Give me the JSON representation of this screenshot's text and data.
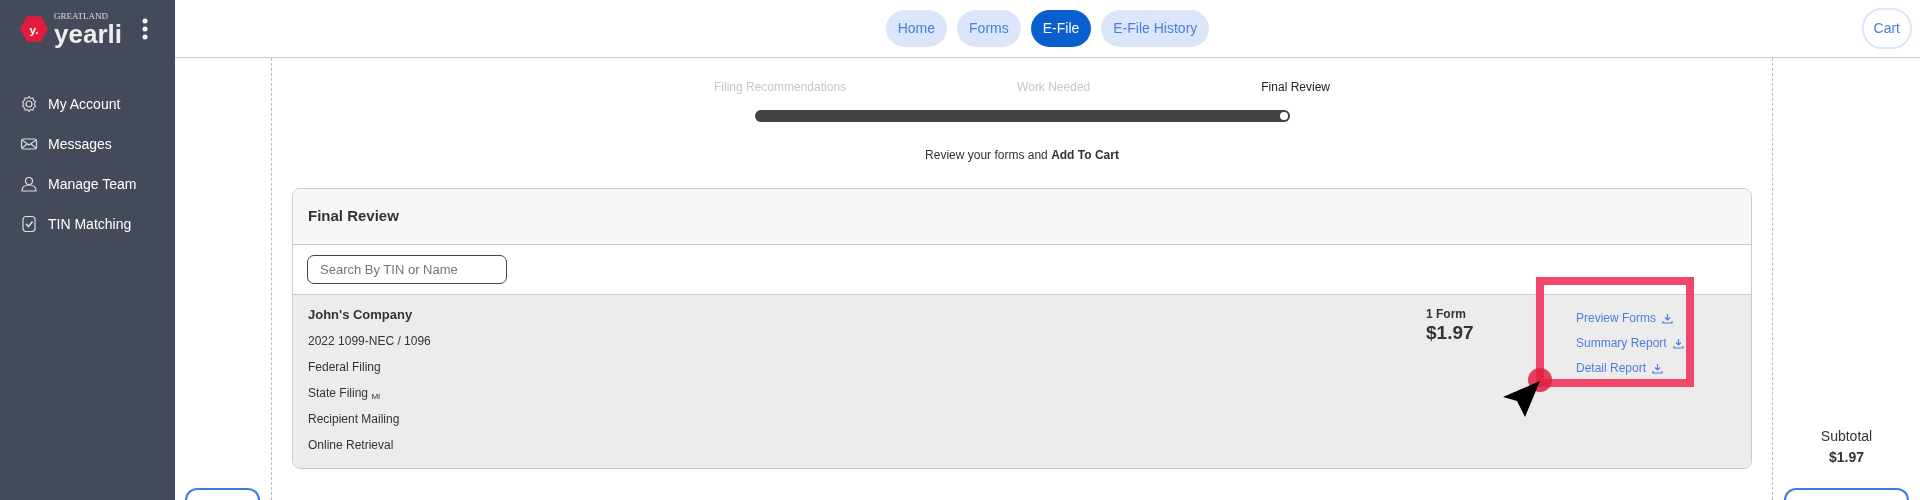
{
  "sidebar": {
    "logo": {
      "small": "GREATLAND",
      "word": "yearli",
      "badge": "y."
    },
    "items": [
      {
        "label": "My Account"
      },
      {
        "label": "Messages"
      },
      {
        "label": "Manage Team"
      },
      {
        "label": "TIN Matching"
      }
    ]
  },
  "top_nav": {
    "tabs": [
      {
        "label": "Home",
        "selected": false
      },
      {
        "label": "Forms",
        "selected": false
      },
      {
        "label": "E-File",
        "selected": true
      },
      {
        "label": "E-File History",
        "selected": false
      }
    ],
    "cart": "Cart"
  },
  "stepper": {
    "steps": [
      {
        "label": "Filing Recommendations",
        "selected": false
      },
      {
        "label": "Work Needed",
        "selected": false
      },
      {
        "label": "Final Review",
        "selected": true
      }
    ],
    "level": 1.0,
    "instruction": "Review your forms and **Add To Cart**"
  },
  "card": {
    "title": "Final Review",
    "search": {
      "placeholder": "Search By TIN or Name"
    },
    "rows": [
      {
        "name": "John's Company",
        "details": [
          "2022 1099-NEC / 1096",
          "Federal Filing",
          "State Filing $_{MI}$",
          "Recipient Mailing",
          "Online Retrieval"
        ],
        "count": "1 Form",
        "price": "$1.97",
        "links": [
          "Preview Forms",
          "Summary Report",
          "Detail Report"
        ]
      }
    ]
  },
  "summary": {
    "label": "Subtotal",
    "amount": "$1.97"
  }
}
